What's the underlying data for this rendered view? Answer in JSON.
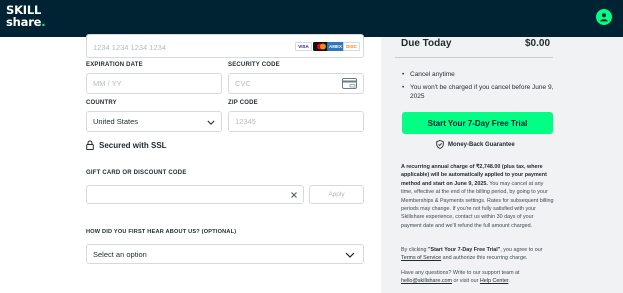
{
  "header": {
    "logo_line1": "SKILL",
    "logo_line2": "share",
    "logo_dot": "."
  },
  "payment": {
    "card_number_placeholder": "1234 1234 1234 1234",
    "cards": [
      "VISA",
      "MC",
      "AMEX",
      "DISC"
    ],
    "expiration_label": "EXPIRATION DATE",
    "expiration_placeholder": "MM / YY",
    "security_label": "SECURITY CODE",
    "security_placeholder": "CVC",
    "country_label": "COUNTRY",
    "country_value": "United States",
    "zip_label": "ZIP CODE",
    "zip_placeholder": "12345",
    "ssl_text": "Secured with SSL"
  },
  "gift": {
    "label": "GIFT CARD OR DISCOUNT CODE",
    "apply_label": "Apply"
  },
  "survey": {
    "label": "HOW DID YOU FIRST HEAR ABOUT US? (OPTIONAL)",
    "value": "Select an option"
  },
  "summary": {
    "title": "Due Today",
    "price": "$0.00",
    "bullets": [
      "Cancel anytime",
      "You won't be charged if you cancel before June 9, 2025"
    ],
    "cta_label": "Start Your 7-Day Free Trial",
    "guarantee": "Money-Back Guarantee",
    "fine_print_bold": "A recurring annual charge of ₹2,748.00 (plus tax, where applicable) will be automatically applied to your payment method and start on June 9, 2025.",
    "fine_print_rest": "You may cancel at any time, effective at the end of the billing period, by going to your Memberships & Payments settings. Rates for subsequent billing periods may change. If you're not fully satisfied with your Skillshare experience, contact us within 30 days of your payment date and we'll refund the full amount charged.",
    "terms_pre": "By clicking ",
    "terms_bold": "\"Start Your 7-Day Free Trial\"",
    "terms_mid": ", you agree to our ",
    "terms_link": "Terms of Service",
    "terms_post": " and authorize this recurring charge.",
    "help_pre": "Have any questions? Write to our support team at ",
    "help_email": "hello@skillshare.com",
    "help_mid": " or visit our ",
    "help_link": "Help Center",
    "help_post": "."
  }
}
